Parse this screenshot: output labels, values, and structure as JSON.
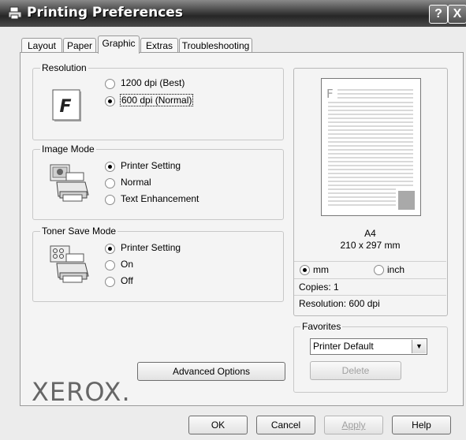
{
  "window": {
    "title": "Printing Preferences",
    "help_symbol": "?",
    "close_symbol": "X"
  },
  "tabs": [
    {
      "label": "Layout"
    },
    {
      "label": "Paper"
    },
    {
      "label": "Graphic",
      "active": true
    },
    {
      "label": "Extras"
    },
    {
      "label": "Troubleshooting"
    }
  ],
  "resolution": {
    "legend": "Resolution",
    "icon": "font-f-icon",
    "icon_letter": "F",
    "options": [
      {
        "label": "1200 dpi (Best)",
        "selected": false
      },
      {
        "label": "600 dpi (Normal)",
        "selected": true
      }
    ]
  },
  "image_mode": {
    "legend": "Image Mode",
    "icon": "printer-image-icon",
    "options": [
      {
        "label": "Printer Setting",
        "selected": true
      },
      {
        "label": "Normal",
        "selected": false
      },
      {
        "label": "Text Enhancement",
        "selected": false
      }
    ]
  },
  "toner_save": {
    "legend": "Toner Save Mode",
    "icon": "printer-toner-icon",
    "options": [
      {
        "label": "Printer Setting",
        "selected": true
      },
      {
        "label": "On",
        "selected": false
      },
      {
        "label": "Off",
        "selected": false
      }
    ]
  },
  "preview": {
    "page_letter": "F",
    "paper_size": "A4",
    "paper_dims": "210 x 297 mm",
    "units": [
      {
        "label": "mm",
        "selected": true
      },
      {
        "label": "inch",
        "selected": false
      }
    ],
    "copies": "Copies: 1",
    "resolution": "Resolution: 600 dpi"
  },
  "favorites": {
    "legend": "Favorites",
    "selected": "Printer Default",
    "delete_label": "Delete"
  },
  "advanced_options_label": "Advanced Options",
  "brand_logo_text": "XEROX.",
  "footer": {
    "ok": "OK",
    "cancel": "Cancel",
    "apply": "Apply",
    "help": "Help"
  },
  "colors": {
    "title_bar": "#3a3a3a",
    "panel": "#f4f4f4",
    "preview_fill": "#a9a9a9"
  }
}
